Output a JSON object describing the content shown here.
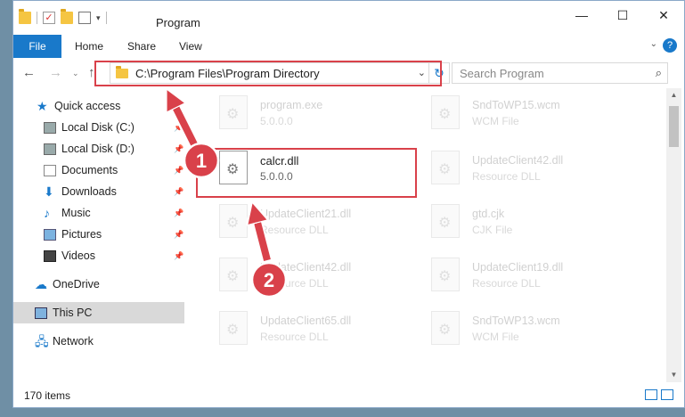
{
  "window": {
    "title": "Program",
    "controls": {
      "minimize": "—",
      "maximize": "☐",
      "close": "✕"
    }
  },
  "ribbon": {
    "tabs": [
      "File",
      "Home",
      "Share",
      "View"
    ],
    "help": "?"
  },
  "address": {
    "path": "C:\\Program Files\\Program Directory",
    "search_placeholder": "Search Program"
  },
  "sidebar": {
    "items": [
      {
        "label": "Quick access",
        "icon": "star-icon"
      },
      {
        "label": "Local Disk (C:)",
        "icon": "disk-icon",
        "pinned": true
      },
      {
        "label": "Local Disk (D:)",
        "icon": "disk-icon",
        "pinned": true
      },
      {
        "label": "Documents",
        "icon": "document-icon",
        "pinned": true
      },
      {
        "label": "Downloads",
        "icon": "download-icon",
        "pinned": true
      },
      {
        "label": "Music",
        "icon": "music-icon",
        "pinned": true
      },
      {
        "label": "Pictures",
        "icon": "picture-icon",
        "pinned": true
      },
      {
        "label": "Videos",
        "icon": "video-icon",
        "pinned": true
      },
      {
        "label": "OneDrive",
        "icon": "cloud-icon"
      },
      {
        "label": "This PC",
        "icon": "computer-icon",
        "selected": true
      },
      {
        "label": "Network",
        "icon": "network-icon"
      }
    ]
  },
  "files": [
    {
      "name": "program.exe",
      "type": "5.0.0.0"
    },
    {
      "name": "SndToWP15.wcm",
      "type": "WCM File"
    },
    {
      "name": "calcr.dll",
      "type": "5.0.0.0"
    },
    {
      "name": "UpdateClient42.dll",
      "type": "Resource DLL"
    },
    {
      "name": "UpdateClient21.dll",
      "type": "Resource DLL"
    },
    {
      "name": "gtd.cjk",
      "type": "CJK File"
    },
    {
      "name": "UpdateClient42.dll",
      "type": "Resource DLL"
    },
    {
      "name": "UpdateClient19.dll",
      "type": "Resource DLL"
    },
    {
      "name": "UpdateClient65.dll",
      "type": "Resource DLL"
    },
    {
      "name": "SndToWP13.wcm",
      "type": "WCM File"
    }
  ],
  "status": {
    "item_count": "170 items"
  },
  "annotations": {
    "step1": "1",
    "step2": "2"
  },
  "colors": {
    "accent": "#1979ca",
    "annotation": "#d9414a"
  }
}
